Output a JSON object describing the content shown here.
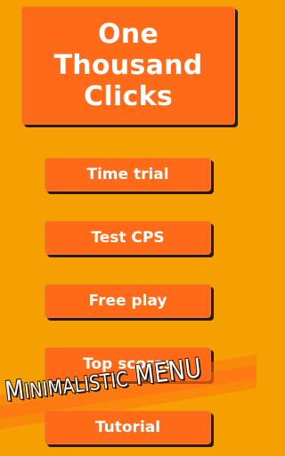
{
  "title": {
    "line1": "One",
    "line2": "Thousand",
    "line3": "Clicks"
  },
  "menu": {
    "time_trial": "Time trial",
    "test_cps": "Test CPS",
    "free_play": "Free play",
    "top_scores": "Top scores",
    "tutorial": "Tutorial"
  },
  "banner": {
    "text": "Minimalistic MENU"
  },
  "colors": {
    "background": "#F5A000",
    "button": "#FF6A18",
    "shadow": "#2A1A05",
    "text": "#FFFFFF"
  }
}
